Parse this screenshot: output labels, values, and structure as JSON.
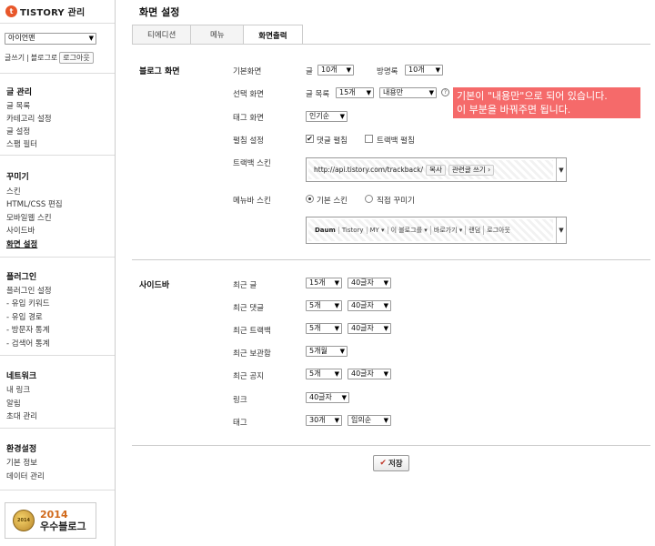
{
  "sidebar": {
    "logo": {
      "mark": "t",
      "text": "TISTORY 관리"
    },
    "blog_select": "아이언맨",
    "links": {
      "write": "글쓰기",
      "divider": "|",
      "blog": "블로그로",
      "logout": "로그아웃"
    },
    "groups": [
      {
        "title": "글 관리",
        "items": [
          "글 목록",
          "카테고리 설정",
          "글 설정",
          "스팸 필터"
        ]
      },
      {
        "title": "꾸미기",
        "items": [
          "스킨",
          "HTML/CSS 편집",
          "모바일웹 스킨",
          "사이드바",
          "화면 설정"
        ]
      },
      {
        "title": "플러그인",
        "items": [
          "플러그인 설정",
          "- 유입 키워드",
          "- 유입 경로",
          "- 방문자 통계",
          "- 검색어 통계"
        ]
      },
      {
        "title": "네트워크",
        "items": [
          "내 링크",
          "알림",
          "초대 관리"
        ]
      },
      {
        "title": "환경설정",
        "items": [
          "기본 정보",
          "데이터 관리"
        ]
      }
    ],
    "active_item": "화면 설정",
    "badge": {
      "medal": "2014",
      "year": "2014",
      "label": "우수블로그"
    }
  },
  "main": {
    "title": "화면 설정",
    "tabs": [
      {
        "label": "티에디션"
      },
      {
        "label": "메뉴"
      },
      {
        "label": "화면출력"
      }
    ],
    "active_tab": "화면출력",
    "blog_screen": {
      "section": "블로그 화면",
      "default_screen": {
        "label": "기본화면",
        "post_label": "글",
        "post_value": "10개",
        "guestbook_label": "방명록",
        "guestbook_value": "10개"
      },
      "selected_screen": {
        "label": "선택 화면",
        "list_label": "글 목록",
        "count": "15개",
        "mode": "내용만",
        "help": "?"
      },
      "tag_screen": {
        "label": "태그 화면",
        "value": "인기순"
      },
      "expand": {
        "label": "펼침 설정",
        "comment": "댓글 펼침",
        "trackback": "트랙백 펼침",
        "comment_checked": true,
        "trackback_checked": false
      },
      "trackback_skin": {
        "label": "트랙백 스킨",
        "url": "http://api.tistory.com/trackback/",
        "copy": "복사",
        "related": "관련글 쓰기 ›"
      },
      "menubar_skin": {
        "label": "메뉴바 스킨",
        "basic": "기본 스킨",
        "custom": "직접 꾸미기",
        "selected": "basic",
        "preview": [
          "Daum",
          "Tistory",
          "MY ▾",
          "이 블로그를 ▾",
          "바로가기 ▾",
          "랜덤",
          "로그아웃"
        ]
      }
    },
    "tooltip": {
      "line1": "기본이 \"내용만\"으로 되어 있습니다.",
      "line2": "이 부분을 바꿔주면 됩니다."
    },
    "sidebar_section": {
      "section": "사이드바",
      "rows": [
        {
          "label": "최근 글",
          "a": "15개",
          "b": "40글자"
        },
        {
          "label": "최근 댓글",
          "a": "5개",
          "b": "40글자"
        },
        {
          "label": "최근 트랙백",
          "a": "5개",
          "b": "40글자"
        },
        {
          "label": "최근 보관함",
          "a": "5개월"
        },
        {
          "label": "최근 공지",
          "a": "5개",
          "b": "40글자"
        },
        {
          "label": "링크",
          "a": "40글자"
        },
        {
          "label": "태그",
          "a": "30개",
          "b": "임의순"
        }
      ]
    },
    "save_label": "저장",
    "save_icon": "✔"
  },
  "icons": {
    "dropdown": "▼",
    "check": "✔"
  },
  "colors": {
    "accent": "#e8572a",
    "tooltip_bg": "#f56a6a",
    "save_check": "#c0392b"
  }
}
